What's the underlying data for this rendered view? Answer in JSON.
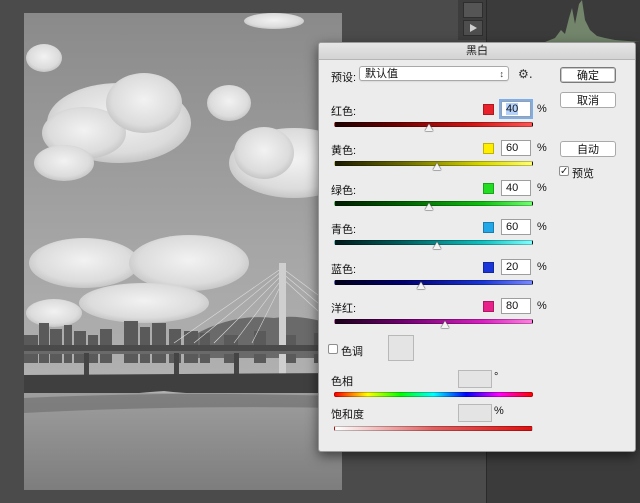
{
  "dialog": {
    "title": "黑白",
    "preset_label": "预设:",
    "preset_value": "默认值",
    "buttons": {
      "ok": "确定",
      "cancel": "取消",
      "auto": "自动"
    },
    "preview": {
      "label": "预览",
      "checked": true
    }
  },
  "sliders": [
    {
      "label": "红色:",
      "value": "40",
      "percent": "%",
      "swatch": "#e8212a",
      "level_percent": 40,
      "focused": true
    },
    {
      "label": "黄色:",
      "value": "60",
      "percent": "%",
      "swatch": "#ffee00",
      "level_percent": 60
    },
    {
      "label": "绿色:",
      "value": "40",
      "percent": "%",
      "swatch": "#22dd22",
      "level_percent": 40
    },
    {
      "label": "青色:",
      "value": "60",
      "percent": "%",
      "swatch": "#22a8e8",
      "level_percent": 60
    },
    {
      "label": "蓝色:",
      "value": "20",
      "percent": "%",
      "swatch": "#1a35d8",
      "level_percent": 20
    },
    {
      "label": "洋红:",
      "value": "80",
      "percent": "%",
      "swatch": "#e8208a",
      "level_percent": 80
    }
  ],
  "tint": {
    "label": "色调",
    "checked": false,
    "hue_label": "色相",
    "hue_unit": "°",
    "saturation_label": "饱和度",
    "saturation_unit": "%"
  },
  "icons": {
    "preset_menu": "gear-icon",
    "dropdown": "chevron-updown-icon"
  }
}
